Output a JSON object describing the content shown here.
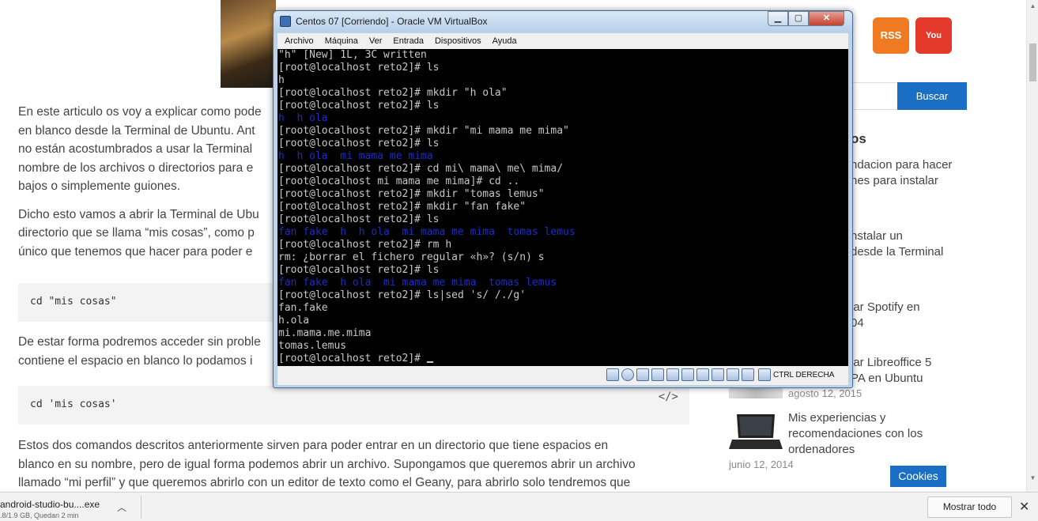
{
  "article": {
    "p1_line1": "En este articulo os voy a explicar como pode",
    "p1_line2": "en blanco desde la Terminal de Ubuntu. Ant",
    "p1_line3": "no están acostumbrados a usar la Terminal",
    "p1_line4": "nombre de los archivos o directorios para e",
    "p1_line5": "bajos o simplemente guiones.",
    "p2_line1": "Dicho esto vamos a abrir la Terminal de Ubu",
    "p2_line2": "directorio que se llama “mis cosas”, como p",
    "p2_line3": "único que tenemos que hacer para poder e",
    "code1": "cd \"mis cosas\"",
    "p3_line1": "De estar forma podremos acceder sin proble",
    "p3_line2": "contiene el espacio en blanco lo podamos i",
    "code2": "cd 'mis cosas'",
    "code_icon": "</>",
    "p4_line1": "Estos dos comandos descritos anteriormente sirven para poder entrar en un directorio que tiene espacios en",
    "p4_line2": "blanco en su nombre, pero de igual forma podemos abrir un archivo. Supongamos que queremos abrir un archivo",
    "p4_line3": "llamado “mi perfil” y que queremos abrirlo con un editor de texto como el Geany, para abrirlo solo tendremos que"
  },
  "sidebar": {
    "rss_glyph": "RSS",
    "youtube_label": "You Tube",
    "search_button": "Buscar",
    "heading_partial": "os",
    "links": [
      {
        "l1": "ndacion para hacer",
        "l2": "nes para instalar"
      },
      {
        "l1": "nstalar un",
        "l2": "desde la Terminal"
      },
      {
        "l1": "lar Spotify en",
        "l2": "04"
      },
      {
        "l1": "lar Libreoffice 5",
        "l2": "PA en Ubuntu"
      }
    ],
    "date1": "agosto 12, 2015",
    "post_title_l1": "Mis experiencias y",
    "post_title_l2": "recomendaciones con los",
    "post_title_l3": "ordenadores",
    "date2": "junio 12, 2014",
    "cookies": "Cookies"
  },
  "download_bar": {
    "file_name": "android-studio-bu....exe",
    "status": ".8/1.9 GB, Quedan 2 min",
    "show_all": "Mostrar todo"
  },
  "vbox": {
    "title": "Centos 07 [Corriendo] - Oracle VM VirtualBox",
    "menu": [
      "Archivo",
      "Máquina",
      "Ver",
      "Entrada",
      "Dispositivos",
      "Ayuda"
    ],
    "host_key": "CTRL DERECHA",
    "terminal_lines": [
      {
        "t": "\"h\" [New] 1L, 3C written",
        "dir": false
      },
      {
        "t": "[root@localhost reto2]# ls",
        "dir": false
      },
      {
        "t": "h",
        "dir": false
      },
      {
        "t": "[root@localhost reto2]# mkdir \"h ola\"",
        "dir": false
      },
      {
        "t": "[root@localhost reto2]# ls",
        "dir": false
      },
      {
        "t": "h  h ola",
        "dir": true
      },
      {
        "t": "[root@localhost reto2]# mkdir \"mi mama me mima\"",
        "dir": false
      },
      {
        "t": "[root@localhost reto2]# ls",
        "dir": false
      },
      {
        "t": "h  h ola  mi mama me mima",
        "dir": true
      },
      {
        "t": "[root@localhost reto2]# cd mi\\ mama\\ me\\ mima/",
        "dir": false
      },
      {
        "t": "[root@localhost mi mama me mima]# cd ..",
        "dir": false
      },
      {
        "t": "[root@localhost reto2]# mkdir \"tomas lemus\"",
        "dir": false
      },
      {
        "t": "[root@localhost reto2]# mkdir \"fan fake\"",
        "dir": false
      },
      {
        "t": "[root@localhost reto2]# ls",
        "dir": false
      },
      {
        "t": "fan fake  h  h ola  mi mama me mima  tomas lemus",
        "dir": true
      },
      {
        "t": "[root@localhost reto2]# rm h",
        "dir": false
      },
      {
        "t": "rm: ¿borrar el fichero regular «h»? (s/n) s",
        "dir": false
      },
      {
        "t": "[root@localhost reto2]# ls",
        "dir": false
      },
      {
        "t": "fan fake  h ola  mi mama me mima  tomas lemus",
        "dir": true
      },
      {
        "t": "[root@localhost reto2]# ls|sed 's/ /./g'",
        "dir": false
      },
      {
        "t": "fan.fake",
        "dir": false
      },
      {
        "t": "h.ola",
        "dir": false
      },
      {
        "t": "mi.mama.me.mima",
        "dir": false
      },
      {
        "t": "tomas.lemus",
        "dir": false
      },
      {
        "t": "[root@localhost reto2]# ",
        "dir": false,
        "cursor": true
      }
    ]
  }
}
